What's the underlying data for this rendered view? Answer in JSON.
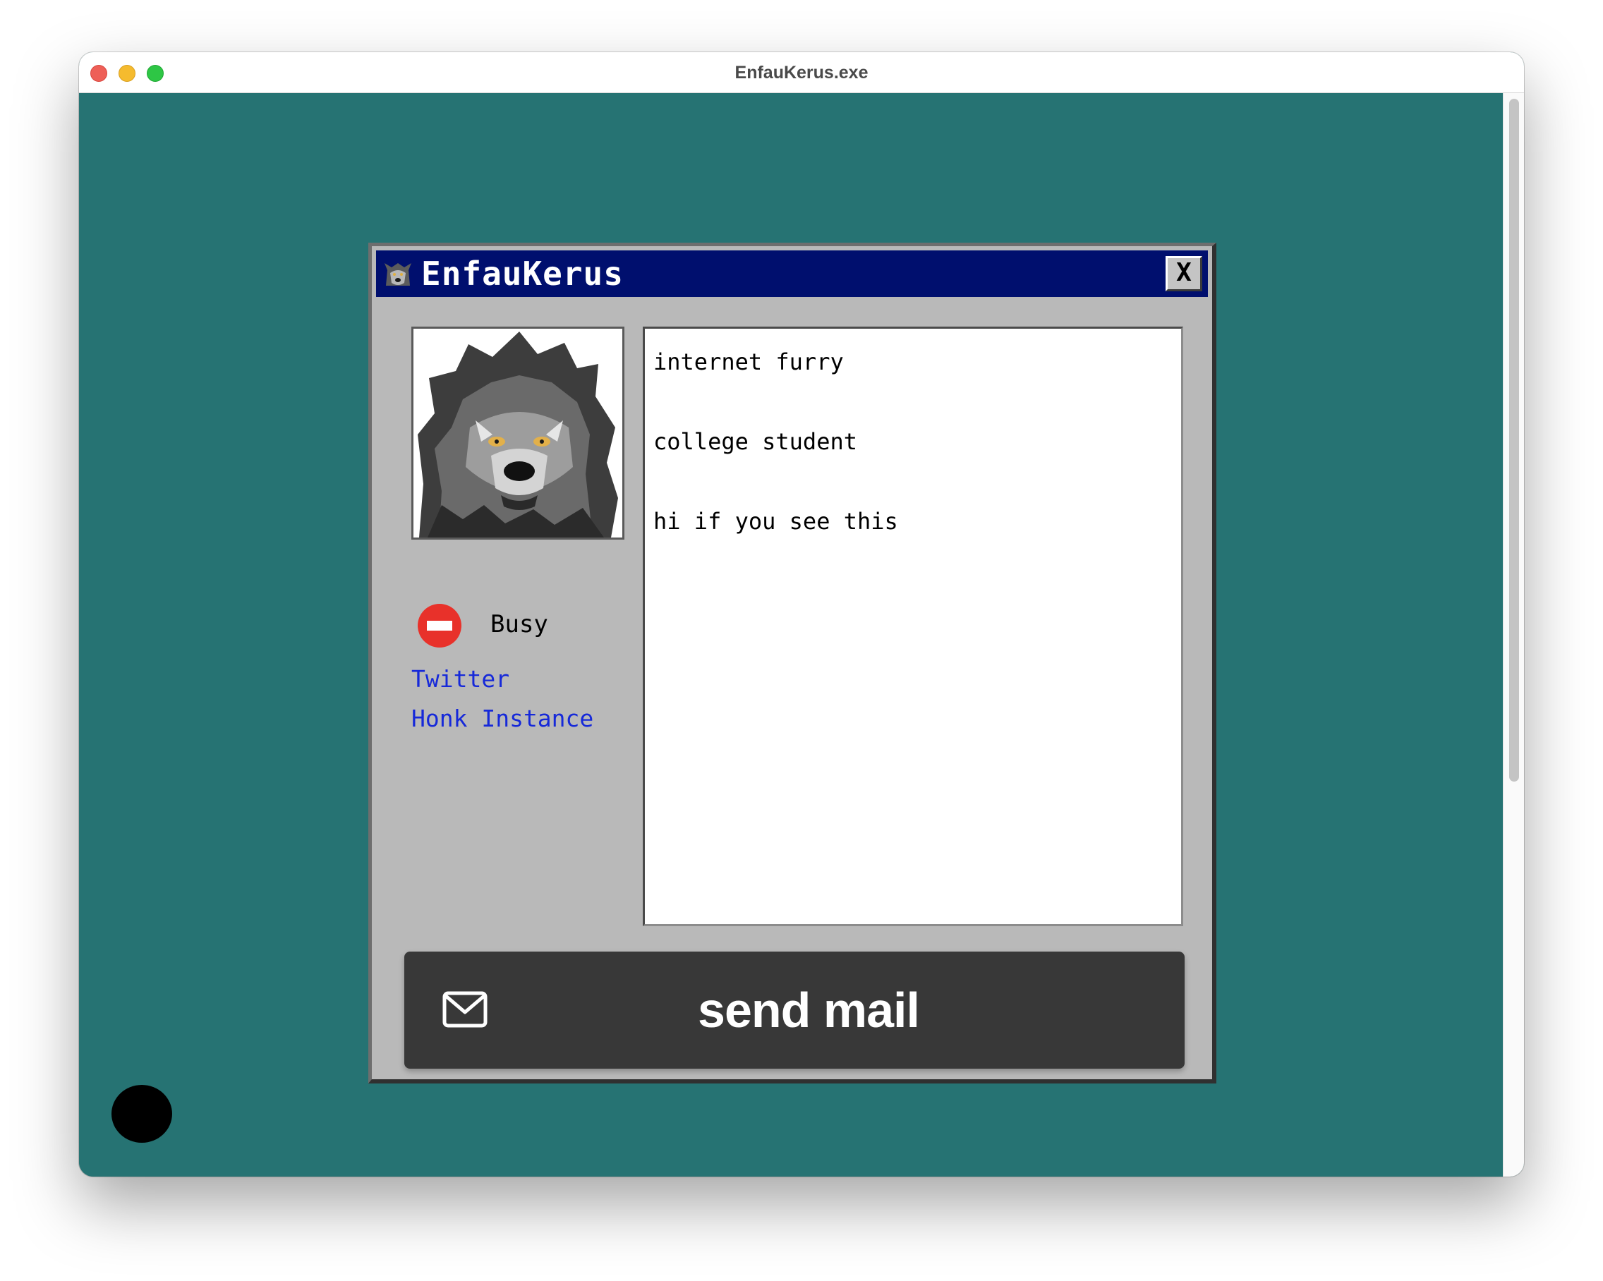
{
  "window": {
    "title": "EnfauKerus.exe"
  },
  "profile": {
    "name": "EnfauKerus",
    "close_label": "X",
    "status": {
      "icon": "busy-icon",
      "text": "Busy",
      "color": "#e8312a"
    },
    "links": [
      {
        "label": "Twitter"
      },
      {
        "label": "Honk Instance"
      }
    ],
    "bio": [
      "internet furry",
      "college student",
      "hi if you see this"
    ],
    "send_button": {
      "icon": "mail-icon",
      "label": "send mail"
    }
  },
  "colors": {
    "desktop": "#267373",
    "titlebar": "#000f6e",
    "panel": "#b9b9b9",
    "link": "#1629d9",
    "button": "#383838"
  }
}
